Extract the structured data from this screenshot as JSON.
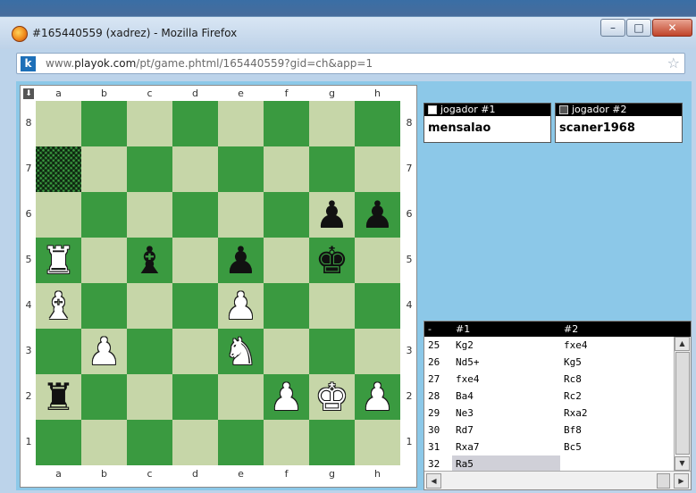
{
  "window": {
    "title": "#165440559 (xadrez) - Mozilla Firefox",
    "buttons": {
      "minimize": "–",
      "maximize": "□",
      "close": "✕"
    }
  },
  "address": {
    "site_icon_letter": "k",
    "url_prefix": "www.",
    "url_host": "playok.com",
    "url_path": "/pt/game.phtml/165440559?gid=ch&app=1"
  },
  "board": {
    "files": [
      "a",
      "b",
      "c",
      "d",
      "e",
      "f",
      "g",
      "h"
    ],
    "ranks": [
      "8",
      "7",
      "6",
      "5",
      "4",
      "3",
      "2",
      "1"
    ],
    "highlight_square": "a7",
    "pieces": {
      "g6": "bP",
      "h6": "bP",
      "a5": "wR",
      "c5": "bB",
      "e5": "bP",
      "g5": "bK",
      "a4": "wB",
      "e4": "wP",
      "b3": "wP",
      "e3": "wN",
      "a2": "bR",
      "f2": "wP",
      "g2": "wK",
      "h2": "wP"
    },
    "glyphs": {
      "K": "♚",
      "Q": "♛",
      "R": "♜",
      "B": "♝",
      "N": "♞",
      "P": "♟"
    }
  },
  "players": [
    {
      "label": "jogador #1",
      "name": "mensalao",
      "color": "white"
    },
    {
      "label": "jogador #2",
      "name": "scaner1968",
      "color": "black"
    }
  ],
  "moves": {
    "headers": {
      "num": "-",
      "white": "#1",
      "black": "#2"
    },
    "rows": [
      {
        "num": "25",
        "white": "Kg2",
        "black": "fxe4"
      },
      {
        "num": "26",
        "white": "Nd5+",
        "black": "Kg5"
      },
      {
        "num": "27",
        "white": "fxe4",
        "black": "Rc8"
      },
      {
        "num": "28",
        "white": "Ba4",
        "black": "Rc2"
      },
      {
        "num": "29",
        "white": "Ne3",
        "black": "Rxa2"
      },
      {
        "num": "30",
        "white": "Rd7",
        "black": "Bf8"
      },
      {
        "num": "31",
        "white": "Rxa7",
        "black": "Bc5"
      },
      {
        "num": "32",
        "white": "Ra5",
        "black": ""
      }
    ],
    "current": "32"
  },
  "colors": {
    "light_square": "#c6d6a8",
    "dark_square": "#3a9a40",
    "panel_bg": "#8cc8e8"
  }
}
